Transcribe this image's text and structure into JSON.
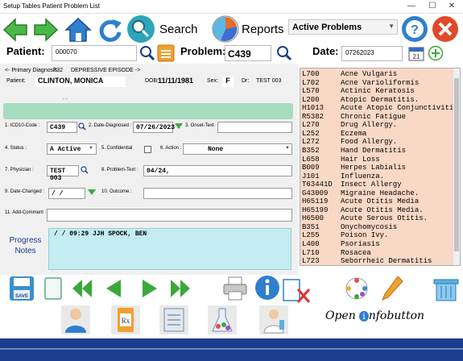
{
  "titlebar": {
    "menu": "Setup Tables  Patient  Problem  List",
    "minimize": "—",
    "maximize": "☐",
    "close": "✕"
  },
  "toolbar": {
    "search_label": "Search",
    "reports_label": "Reports",
    "problem_filter": "Active Problems"
  },
  "patient_bar": {
    "patient_label": "Patient:",
    "patient_value": "000070",
    "problem_label": "Problem:",
    "problem_value": "C439",
    "date_label": "Date:",
    "date_value": "07262023"
  },
  "header": {
    "primary_diagnosis_label": "<- Primary Diagnosis",
    "primary_diagnosis_code": "F32",
    "primary_diagnosis_text": "DEPRESSIVE EPISODE ->",
    "patient_label": "Patient:",
    "patient_name": "CLINTON, MONICA",
    "dob_label": "DOB:",
    "dob_value": "11/11/1981",
    "sex_label": "Sex:",
    "sex_value": "F",
    "dr_label": "Dr:",
    "dr_value": "TEST 003",
    "dots": ". ."
  },
  "form": {
    "icd10_label": "1. ICD10-Code :",
    "icd10_value": "C439",
    "date_diag_label": "2. Date-Diagnosed :",
    "date_diag_value": "07/26/2023",
    "onset_label": "3. Onset-Text",
    "onset_value": "",
    "status_label": "4. Status :",
    "status_value": "A  Active",
    "confidential_label": "5. Confidential",
    "action_label": "6. Action :",
    "action_value": "None",
    "physician_label": "7. Physician :",
    "physician_value": "TEST 003",
    "problem_text_label": "8. Problem-Text :",
    "problem_text_value": "04/24,",
    "date_changed_label": "9. Date-Changed :",
    "date_changed_value": " /  /",
    "outcome_label": "10. Outcome :",
    "outcome_value": "",
    "add_comment_label": "11. Add-Comment :",
    "add_comment_value": ""
  },
  "progress": {
    "label_line1": "Progress",
    "label_line2": "Notes",
    "entry": " /  /      09:29  JJH   SPOCK, BEN"
  },
  "problem_list": [
    {
      "code": "L700",
      "desc": "Acne Vulgaris"
    },
    {
      "code": "L702",
      "desc": "Acne Varioliformis"
    },
    {
      "code": "L570",
      "desc": "Actinic Keratosis"
    },
    {
      "code": "L200",
      "desc": "Atopic Dermatitis."
    },
    {
      "code": "H1013",
      "desc": "Acute Atopic Conjunctiviti"
    },
    {
      "code": "R5382",
      "desc": "Chronic Fatigue"
    },
    {
      "code": "L270",
      "desc": "Drug Allergy."
    },
    {
      "code": "L252",
      "desc": "Eczema"
    },
    {
      "code": "L272",
      "desc": "Food Allergy."
    },
    {
      "code": "B352",
      "desc": "Hand Dermatitis"
    },
    {
      "code": "L658",
      "desc": "Hair Loss"
    },
    {
      "code": "B009",
      "desc": "Herpes Labialis"
    },
    {
      "code": "J101",
      "desc": "Influenza."
    },
    {
      "code": "T63441D",
      "desc": "Insect Allergy"
    },
    {
      "code": "G43009",
      "desc": "Migraine Headache."
    },
    {
      "code": "H65119",
      "desc": "Acute Otitis Media"
    },
    {
      "code": "H65199",
      "desc": "Acute Otitis Media."
    },
    {
      "code": "H6500",
      "desc": "Acute Serous Otitis."
    },
    {
      "code": "B351",
      "desc": "Onychomycosis"
    },
    {
      "code": "L255",
      "desc": "Poison Ivy."
    },
    {
      "code": "L400",
      "desc": "Psoriasis"
    },
    {
      "code": "L710",
      "desc": "Rosacea"
    },
    {
      "code": "L723",
      "desc": "Seborrheic Dermatitis"
    }
  ],
  "bottom": {
    "save_label": "SAVE",
    "open_infobutton_prefix": "Open ",
    "open_infobutton_i": "i",
    "open_infobutton_rest": "nfobutton"
  },
  "colors": {
    "list_bg": "#f9d8c6",
    "progress_bg": "#c4ecf2",
    "accent_green": "#3aa93a",
    "accent_blue": "#1d3d8c"
  }
}
